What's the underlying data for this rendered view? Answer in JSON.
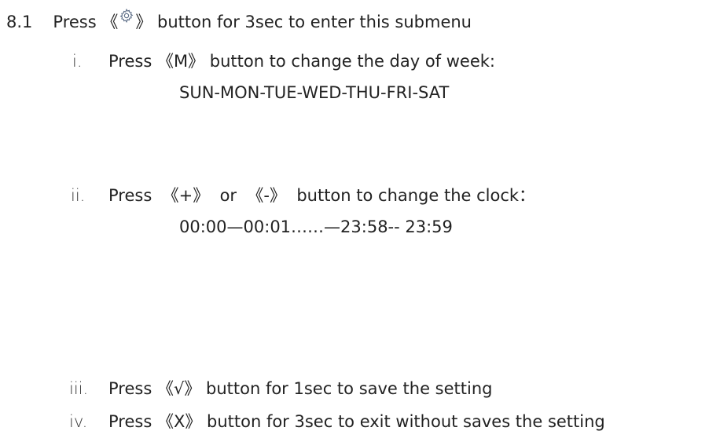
{
  "section": {
    "number": "8.1",
    "text_before_icon": "Press 《",
    "icon": "gear-icon",
    "text_after_icon": "》 button for 3sec to enter this submenu"
  },
  "steps": [
    {
      "numeral": "i.",
      "text": "Press 《M》 button to change the day of week:",
      "detail": "SUN-MON-TUE-WED-THU-FRI-SAT"
    },
    {
      "numeral": "ii.",
      "text": "Press  《+》  or  《-》  button to change the clock：",
      "detail": "00:00—00:01……—23:58-- 23:59"
    },
    {
      "numeral": "iii.",
      "text": "Press 《√》 button for 1sec to save the setting"
    },
    {
      "numeral": "iv.",
      "text": "Press 《X》 button for 3sec to exit without saves the setting"
    }
  ]
}
